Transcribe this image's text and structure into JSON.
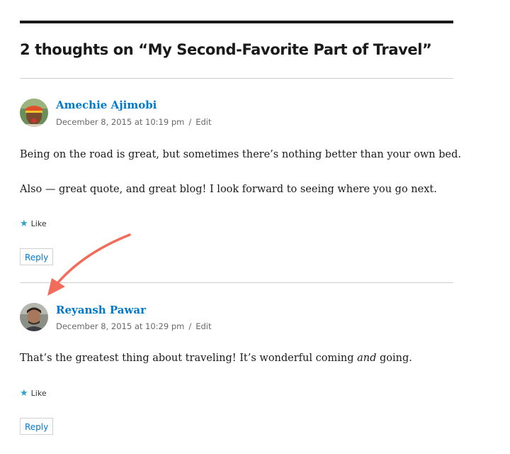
{
  "title": "2 thoughts on “My Second-Favorite Part of Travel”",
  "comments": [
    {
      "author": "Amechie Ajimobi",
      "date": "December 8, 2015 at 10:19 pm",
      "separator": "/",
      "edit_label": "Edit",
      "paragraphs": [
        "Being on the road is great, but sometimes there’s nothing better than your own bed.",
        "Also — great quote, and great blog! I look forward to seeing where you go next."
      ],
      "like_label": "Like",
      "reply_label": "Reply"
    },
    {
      "author": "Reyansh Pawar",
      "date": "December 8, 2015 at 10:29 pm",
      "separator": "/",
      "edit_label": "Edit",
      "paragraph_before": "That’s the greatest thing about traveling! It’s wonderful coming ",
      "paragraph_emphasis": "and",
      "paragraph_after": " going.",
      "like_label": "Like",
      "reply_label": "Reply"
    }
  ],
  "colors": {
    "link": "#007acc",
    "meta": "#686868",
    "divider": "#d1d1d1",
    "star": "#2ea2cc",
    "annotation_arrow": "#f26b5b"
  },
  "icons": {
    "like": "star-icon",
    "annotation": "curved-arrow-icon"
  }
}
